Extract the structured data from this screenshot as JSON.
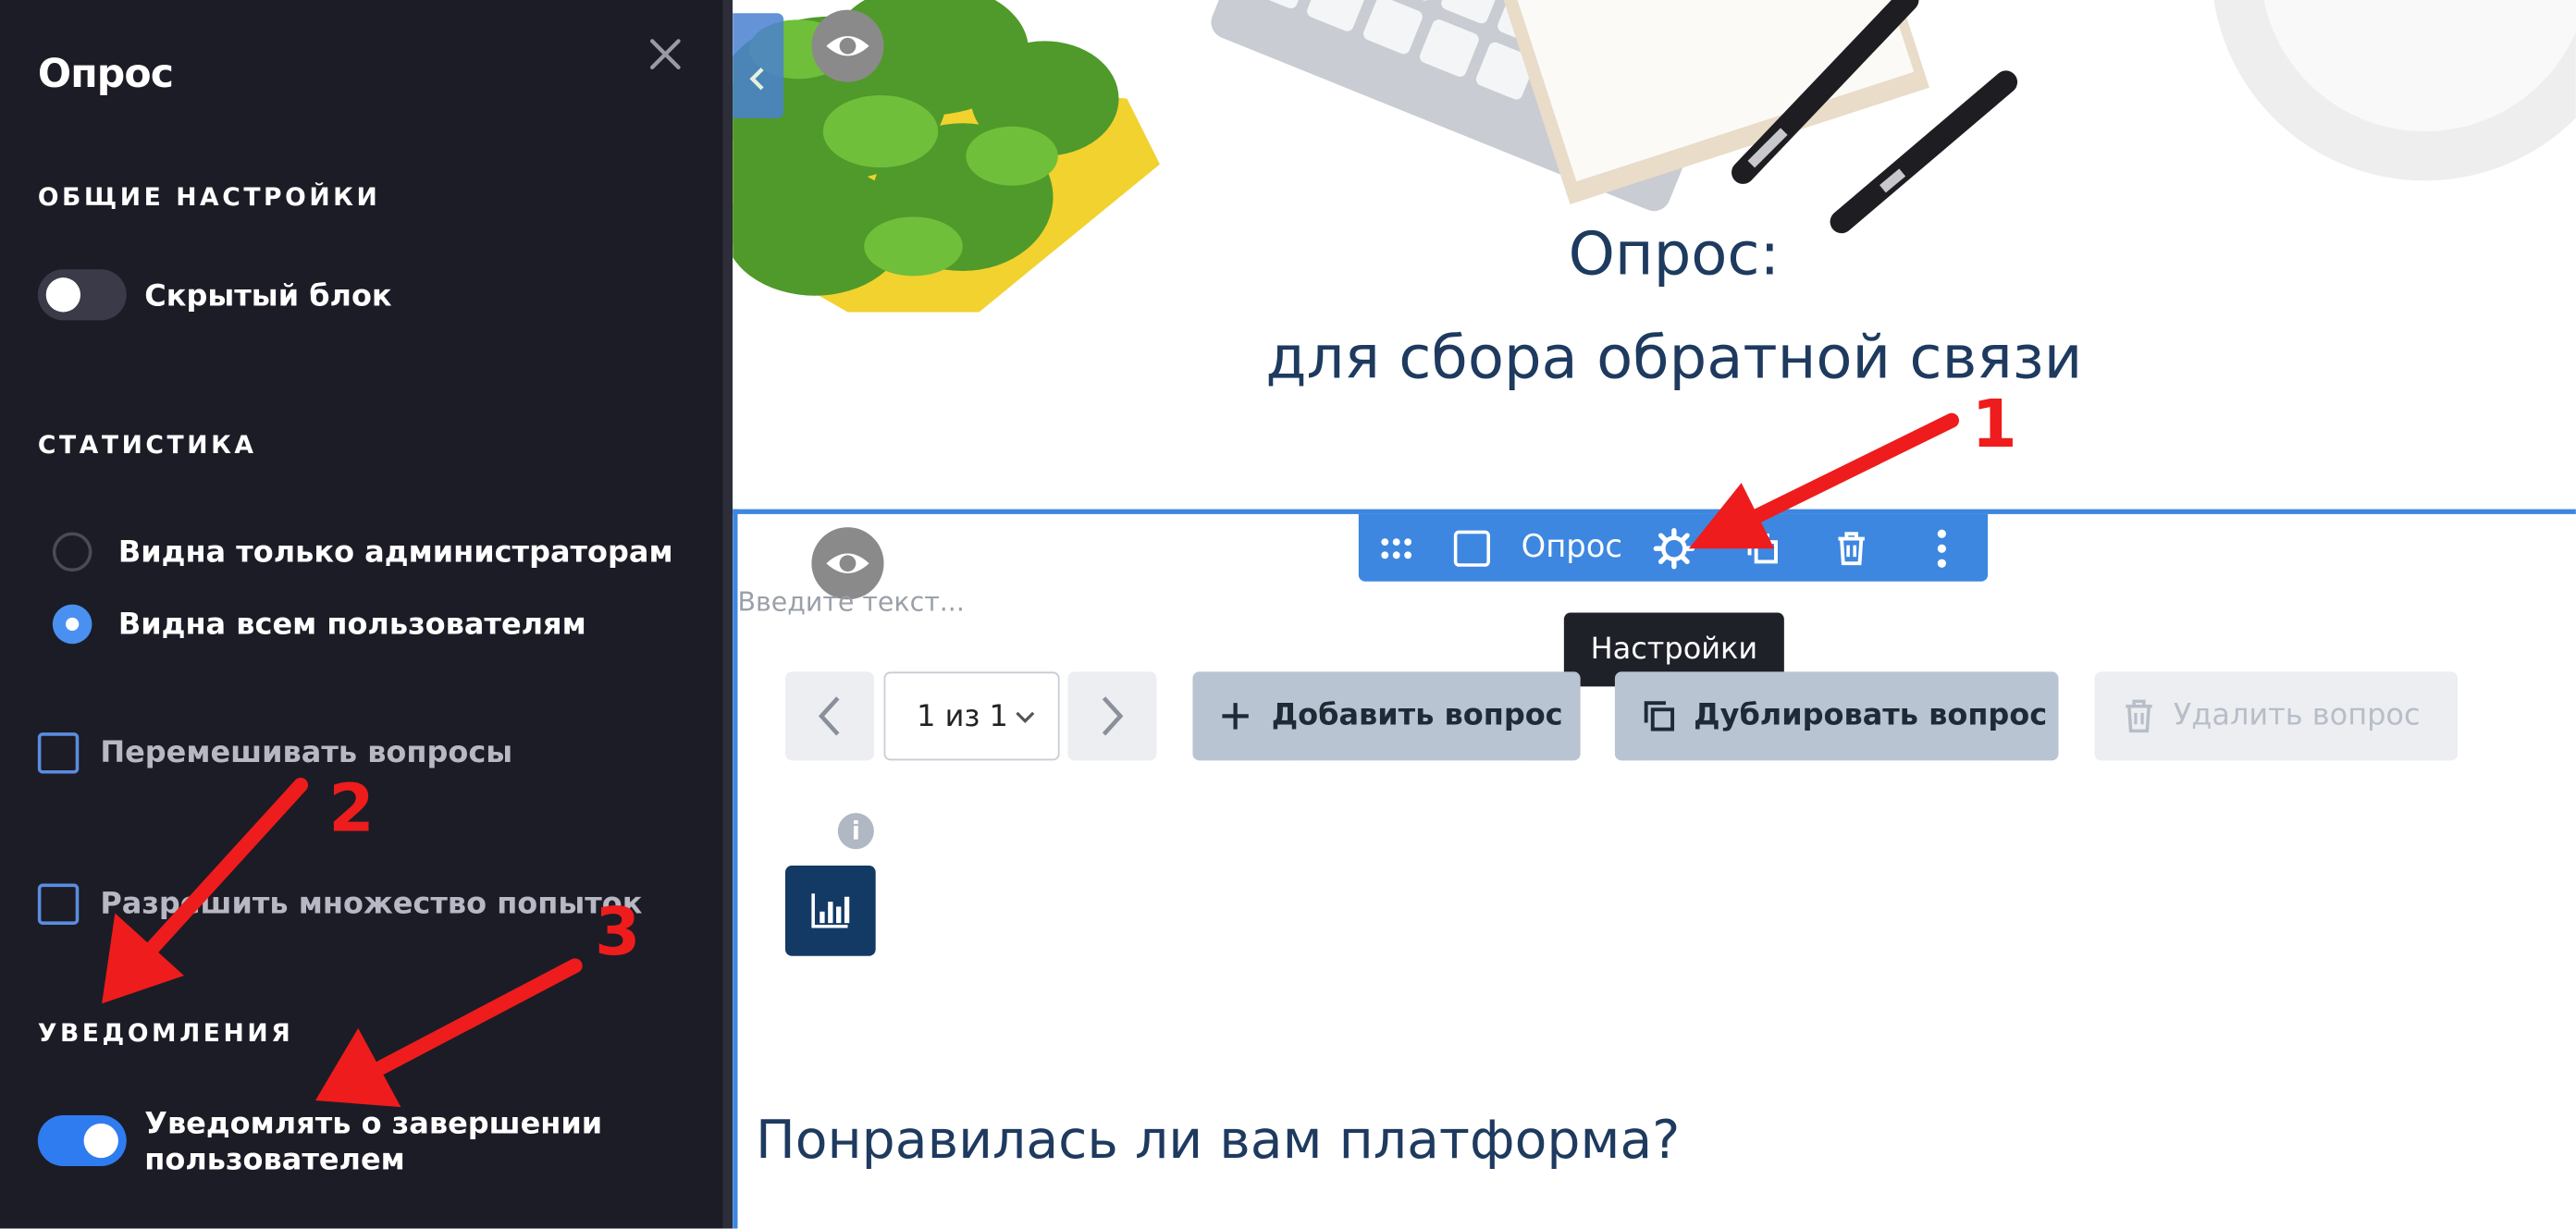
{
  "sidebar": {
    "title": "Опрос",
    "general_section": "ОБЩИЕ НАСТРОЙКИ",
    "hidden_block_label": "Скрытый блок",
    "stats_section": "СТАТИСТИКА",
    "radio_admins_label": "Видна только администраторам",
    "radio_all_label": "Видна всем пользователям",
    "shuffle_label": "Перемешивать вопросы",
    "attempts_label": "Разрешить множество попыток",
    "notify_section": "УВЕДОМЛЕНИЯ",
    "notify_label_line1": "Уведомлять о завершении",
    "notify_label_line2": "пользователем"
  },
  "hero": {
    "title_line1": "Опрос:",
    "title_line2": "для сбора обратной связи"
  },
  "toolbar": {
    "block_label": "Опрос"
  },
  "tooltip": "Настройки",
  "editor": {
    "placeholder": "Введите текст...",
    "pager_text": "1 из 1",
    "add_question": "Добавить вопрос",
    "duplicate_question": "Дублировать вопрос",
    "delete_question": "Удалить вопрос",
    "info_glyph": "i",
    "question_text": "Понравилась ли вам платформа?"
  },
  "annotations": {
    "label_1": "1",
    "label_2": "2",
    "label_3": "3",
    "color": "#ee1c1c"
  },
  "colors": {
    "sidebar_bg": "#1c1c26",
    "accent_blue": "#3d87e0",
    "heading_navy": "#1e3a5f",
    "stats_button": "#123a64"
  }
}
